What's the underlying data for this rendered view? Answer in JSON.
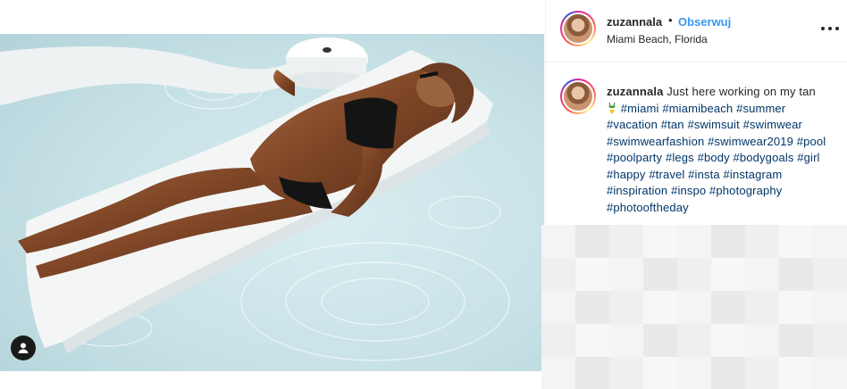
{
  "post": {
    "author": {
      "username": "zuzannala",
      "separator": "•",
      "follow_label": "Obserwuj",
      "location": "Miami Beach, Florida",
      "avatar_icon": "profile-avatar"
    },
    "more_icon": "more-horizontal-icon",
    "photo": {
      "tag_icon": "user-tag-icon",
      "water_color": "#cfe6ea",
      "lounger_color": "#f4f6f6"
    },
    "caption": {
      "username": "zuzannala",
      "text": "Just here working on my tan",
      "emoji_icon": "bikini-emoji",
      "hashtags": [
        "#miami",
        "#miamibeach",
        "#summer",
        "#vacation",
        "#tan",
        "#swimsuit",
        "#swimwear",
        "#swimwearfashion",
        "#swimwear2019",
        "#pool",
        "#poolparty",
        "#legs",
        "#body",
        "#bodygoals",
        "#girl",
        "#happy",
        "#travel",
        "#insta",
        "#instagram",
        "#inspiration",
        "#inspo",
        "#photography",
        "#photooftheday"
      ]
    },
    "colors": {
      "link": "#003569",
      "follow": "#3897f0",
      "text": "#262626",
      "border": "#efefef"
    }
  }
}
